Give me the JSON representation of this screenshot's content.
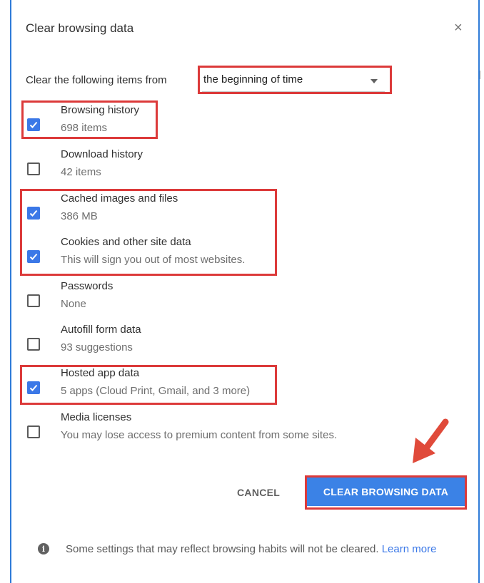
{
  "dialog": {
    "title": "Clear browsing data",
    "close_glyph": "×"
  },
  "time_range": {
    "label": "Clear the following items from",
    "selected": "the beginning of time"
  },
  "items": [
    {
      "label": "Browsing history",
      "sub": "698 items",
      "checked": true
    },
    {
      "label": "Download history",
      "sub": "42 items",
      "checked": false
    },
    {
      "label": "Cached images and files",
      "sub": "386 MB",
      "checked": true
    },
    {
      "label": "Cookies and other site data",
      "sub": "This will sign you out of most websites.",
      "checked": true
    },
    {
      "label": "Passwords",
      "sub": "None",
      "checked": false
    },
    {
      "label": "Autofill form data",
      "sub": "93 suggestions",
      "checked": false
    },
    {
      "label": "Hosted app data",
      "sub": "5 apps (Cloud Print, Gmail, and 3 more)",
      "checked": true
    },
    {
      "label": "Media licenses",
      "sub": "You may lose access to premium content from some sites.",
      "checked": false
    }
  ],
  "buttons": {
    "cancel": "CANCEL",
    "clear": "CLEAR BROWSING DATA"
  },
  "footer": {
    "info_glyph": "i",
    "text": "Some settings that may reflect browsing habits will not be cleared.",
    "link": "Learn more"
  },
  "colors": {
    "accent": "#3b78e7",
    "highlight": "#dc3a3a"
  }
}
